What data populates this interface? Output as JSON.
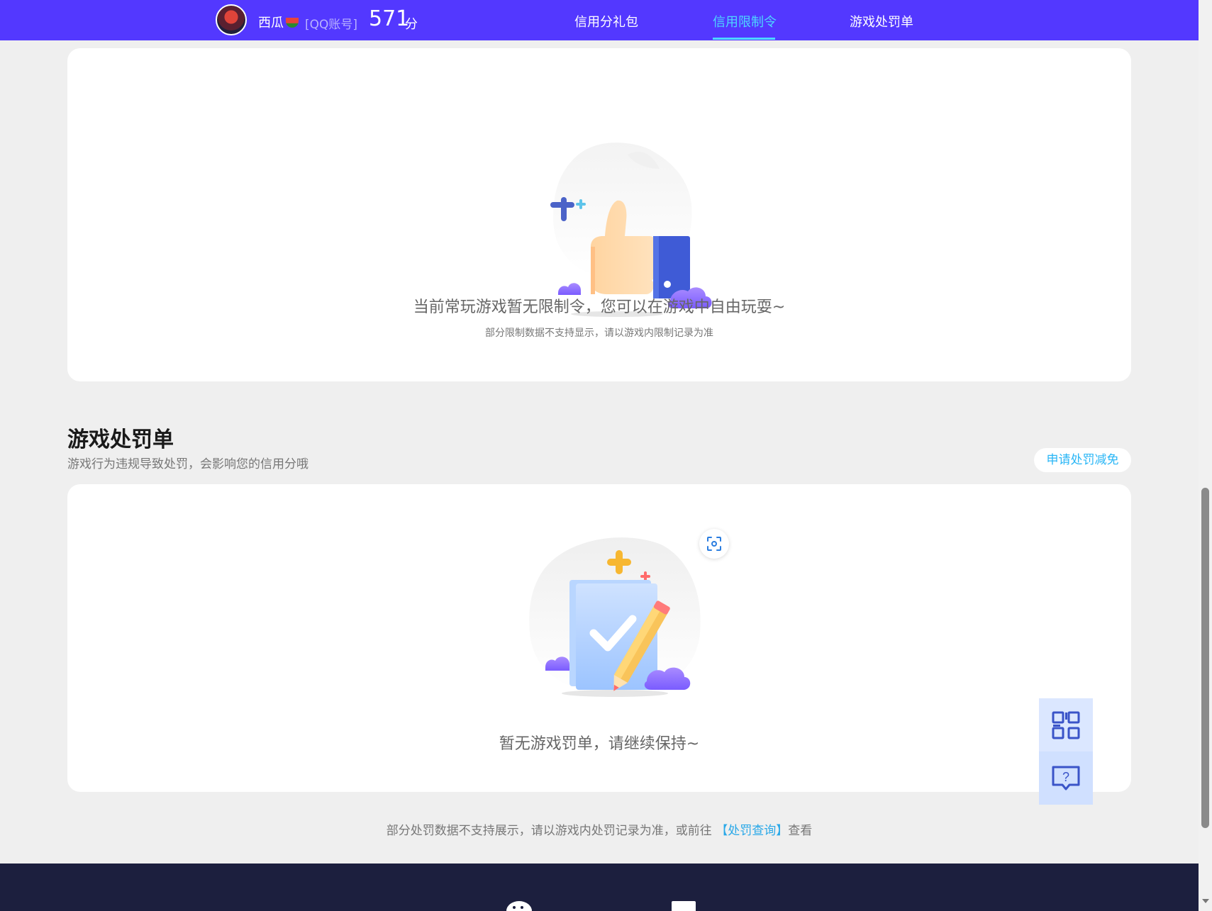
{
  "header": {
    "username": "西瓜",
    "account_type": "[QQ账号]",
    "score": "571",
    "score_unit": "分",
    "tabs": [
      {
        "label": "信用分礼包",
        "active": false
      },
      {
        "label": "信用限制令",
        "active": true
      },
      {
        "label": "游戏处罚单",
        "active": false
      }
    ]
  },
  "restriction_card": {
    "message": "当前常玩游戏暂无限制令，您可以在游戏中自由玩耍~",
    "note": "部分限制数据不支持显示，请以游戏内限制记录为准"
  },
  "penalty_section": {
    "title": "游戏处罚单",
    "subtitle": "游戏行为违规导致处罚，会影响您的信用分哦",
    "apply_button": "申请处罚减免",
    "empty_message": "暂无游戏罚单，请继续保持~"
  },
  "footer_note": {
    "before": "部分处罚数据不支持展示，请以游戏内处罚记录为准，或前往",
    "link": "【处罚查询】",
    "after": "查看"
  },
  "float_panel": {
    "icons": [
      "qr-code-icon",
      "help-chat-icon"
    ]
  },
  "colors": {
    "header_bg": "#5338ff",
    "active_tab": "#4dd6ff",
    "link": "#29a8e8",
    "footer_bg": "#1c1f3e"
  }
}
